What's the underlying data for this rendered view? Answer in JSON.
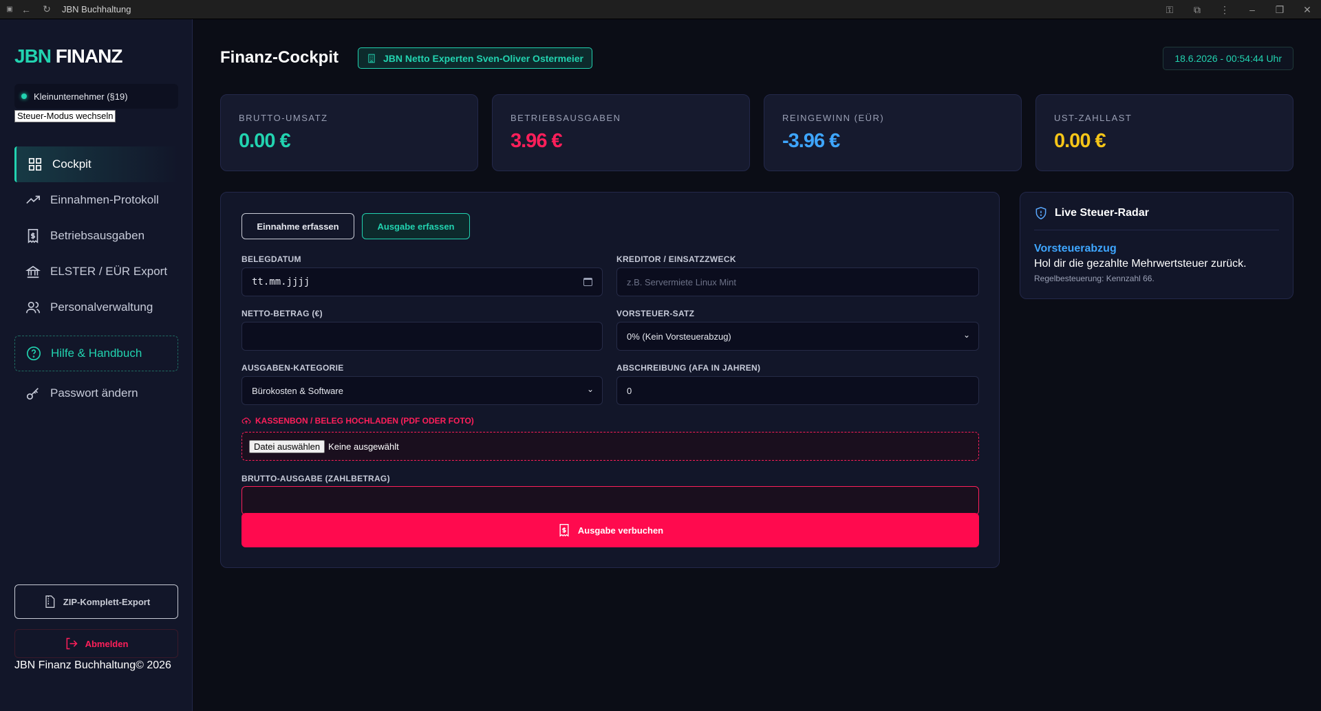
{
  "browser": {
    "title": "JBN Buchhaltung"
  },
  "sidebar": {
    "logo_a": "JBN",
    "logo_b": "FINANZ",
    "mode_label": "Kleinunternehmer (§19)",
    "mode_button": "Steuer-Modus wechseln",
    "items": [
      {
        "label": "Cockpit",
        "icon": "grid-icon"
      },
      {
        "label": "Einnahmen-Protokoll",
        "icon": "trend-icon"
      },
      {
        "label": "Betriebsausgaben",
        "icon": "receipt-icon"
      },
      {
        "label": "ELSTER / EÜR Export",
        "icon": "bank-icon"
      },
      {
        "label": "Personalverwaltung",
        "icon": "users-icon"
      },
      {
        "label": "Hilfe & Handbuch",
        "icon": "help-icon"
      },
      {
        "label": "Passwort ändern",
        "icon": "key-icon"
      }
    ],
    "zip_export": "ZIP-Komplett-Export",
    "logout": "Abmelden",
    "copyright": "JBN Finanz Buchhaltung© 2026"
  },
  "header": {
    "title": "Finanz-Cockpit",
    "company": "JBN Netto Experten Sven-Oliver Ostermeier",
    "datetime": "18.6.2026 - 00:54:44 Uhr"
  },
  "kpis": [
    {
      "label": "BRUTTO-UMSATZ",
      "value": "0.00 €",
      "color": "#22d3b0"
    },
    {
      "label": "BETRIEBSAUSGABEN",
      "value": "3.96 €",
      "color": "#ff1f5a"
    },
    {
      "label": "REINGEWINN (EÜR)",
      "value": "-3.96 €",
      "color": "#3ea6ff"
    },
    {
      "label": "UST-ZAHLLAST",
      "value": "0.00 €",
      "color": "#f5c518"
    }
  ],
  "form": {
    "tab_income": "Einnahme erfassen",
    "tab_expense": "Ausgabe erfassen",
    "date_label": "BELEGDATUM",
    "date_value": "tt.mm.jjjj",
    "creditor_label": "KREDITOR / EINSATZZWECK",
    "creditor_placeholder": "z.B. Servermiete Linux Mint",
    "net_label": "NETTO-BETRAG (€)",
    "net_value": "",
    "vat_label": "VORSTEUER-SATZ",
    "vat_value": "0% (Kein Vorsteuerabzug)",
    "category_label": "AUSGABEN-KATEGORIE",
    "category_value": "Bürokosten & Software",
    "afa_label": "ABSCHREIBUNG (AFA IN JAHREN)",
    "afa_value": "0",
    "upload_label": "KASSENBON / BELEG HOCHLADEN (PDF ODER FOTO)",
    "file_button": "Datei auswählen",
    "file_status": "Keine ausgewählt",
    "gross_label": "BRUTTO-AUSGABE (ZAHLBETRAG)",
    "gross_value": "",
    "submit": "Ausgabe verbuchen"
  },
  "radar": {
    "title": "Live Steuer-Radar",
    "heading": "Vorsteuerabzug",
    "text": "Hol dir die gezahlte Mehrwertsteuer zurück.",
    "note": "Regelbesteuerung: Kennzahl 66."
  }
}
